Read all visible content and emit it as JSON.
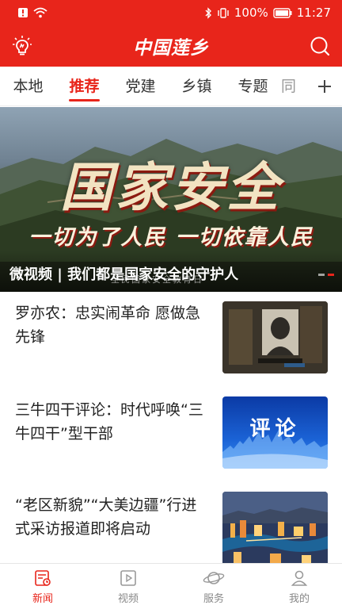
{
  "status_bar": {
    "battery": "100%",
    "time": "11:27"
  },
  "app_bar": {
    "title": "中国莲乡"
  },
  "tabs": [
    {
      "label": "本地",
      "active": false
    },
    {
      "label": "推荐",
      "active": true
    },
    {
      "label": "党建",
      "active": false
    },
    {
      "label": "乡镇",
      "active": false
    },
    {
      "label": "专题",
      "active": false
    },
    {
      "label": "同",
      "active": false
    }
  ],
  "banner": {
    "art_title": "国家安全",
    "slogan": "一切为了人民 一切依靠人民",
    "caption": "微视频 | 我们都是国家安全的守护人",
    "sub_text": "全民国家安全教育日"
  },
  "news": [
    {
      "title": "罗亦农：忠实闹革命 愿做急先锋",
      "thumb": "portrait"
    },
    {
      "title": "三牛四干评论：时代呼唤“三牛四干”型干部",
      "thumb_text": "评论"
    },
    {
      "title": "“老区新貌”“大美边疆”行进式采访报道即将启动",
      "thumb": "city-night"
    }
  ],
  "bottom_nav": [
    {
      "label": "新闻",
      "icon": "news-icon",
      "active": true
    },
    {
      "label": "视频",
      "icon": "video-icon",
      "active": false
    },
    {
      "label": "服务",
      "icon": "service-icon",
      "active": false
    },
    {
      "label": "我的",
      "icon": "profile-icon",
      "active": false
    }
  ],
  "colors": {
    "brand": "#e8251b"
  }
}
